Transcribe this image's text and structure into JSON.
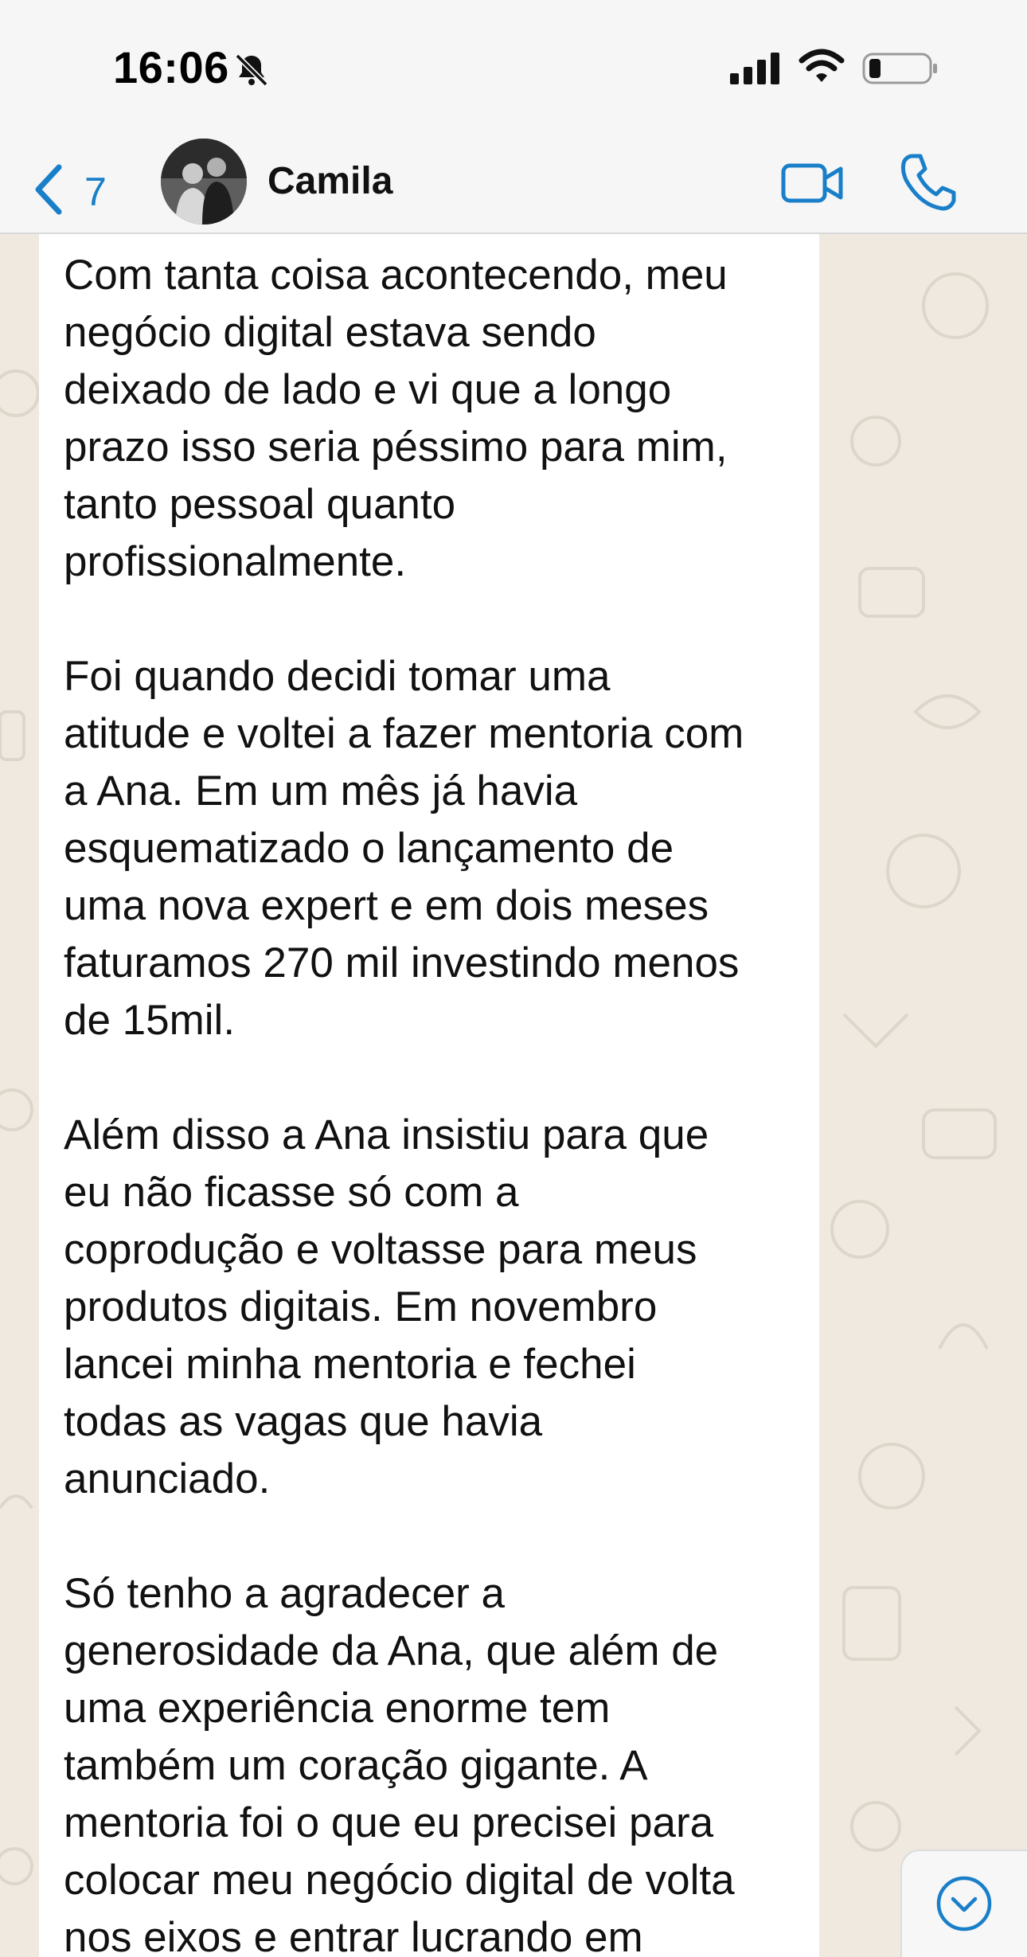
{
  "status_bar": {
    "time": "16:06",
    "icons": [
      "bell-slash-icon",
      "cellular-signal-icon",
      "wifi-icon",
      "battery-low-icon"
    ]
  },
  "header": {
    "back_count": "7",
    "contact_name": "Camila",
    "icons": [
      "chevron-left-icon",
      "video-camera-icon",
      "phone-icon"
    ],
    "accent_color": "#1a7fc9"
  },
  "message": {
    "lines": [
      "Com tanta coisa acontecendo, meu",
      "negócio digital estava sendo",
      "deixado de lado e vi que a longo",
      "prazo isso seria péssimo para mim,",
      "tanto pessoal quanto",
      "profissionalmente.",
      "",
      "Foi quando decidi tomar uma",
      "atitude e voltei a fazer mentoria com",
      "a Ana. Em um mês já havia",
      "esquematizado o lançamento de",
      "uma nova expert e em dois meses",
      "faturamos 270 mil investindo menos",
      "de 15mil.",
      "",
      "Além disso a Ana insistiu para que",
      "eu não ficasse só com a",
      "coprodução e voltasse para meus",
      "produtos digitais. Em novembro",
      "lancei minha mentoria e fechei",
      "todas as vagas que havia",
      "anunciado.",
      "",
      "Só tenho a agradecer a",
      "generosidade da Ana, que além de",
      "uma experiência enorme tem",
      "também um coração gigante. A",
      "mentoria foi o que eu precisei para",
      "colocar meu negócio digital de volta",
      "nos eixos e entrar lucrando em"
    ]
  },
  "controls": {
    "scroll_down_icon": "chevron-down-circle-icon"
  },
  "colors": {
    "wallpaper": "#efe9df",
    "bubble": "#ffffff",
    "bar": "#f6f6f6"
  }
}
